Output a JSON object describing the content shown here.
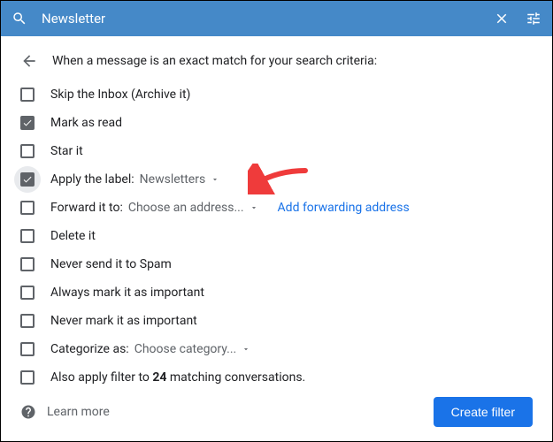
{
  "header": {
    "title": "Newsletter"
  },
  "heading": "When a message is an exact match for your search criteria:",
  "options": {
    "skip_inbox": {
      "label": "Skip the Inbox (Archive it)",
      "checked": false
    },
    "mark_read": {
      "label": "Mark as read",
      "checked": true
    },
    "star": {
      "label": "Star it",
      "checked": false
    },
    "apply_label": {
      "label": "Apply the label:",
      "checked": true,
      "dropdown": "Newsletters"
    },
    "forward": {
      "label": "Forward it to:",
      "checked": false,
      "dropdown": "Choose an address...",
      "link": "Add forwarding address"
    },
    "delete": {
      "label": "Delete it",
      "checked": false
    },
    "never_spam": {
      "label": "Never send it to Spam",
      "checked": false
    },
    "always_important": {
      "label": "Always mark it as important",
      "checked": false
    },
    "never_important": {
      "label": "Never mark it as important",
      "checked": false
    },
    "categorize": {
      "label": "Categorize as:",
      "checked": false,
      "dropdown": "Choose category..."
    },
    "also_apply": {
      "prefix": "Also apply filter to ",
      "count": "24",
      "suffix": " matching conversations.",
      "checked": false
    }
  },
  "footer": {
    "learn_more": "Learn more",
    "create_button": "Create filter"
  },
  "colors": {
    "header_bg": "#4589c8",
    "primary_button": "#1a73e8",
    "link": "#1a73e8",
    "arrow": "#ef3b3b"
  }
}
